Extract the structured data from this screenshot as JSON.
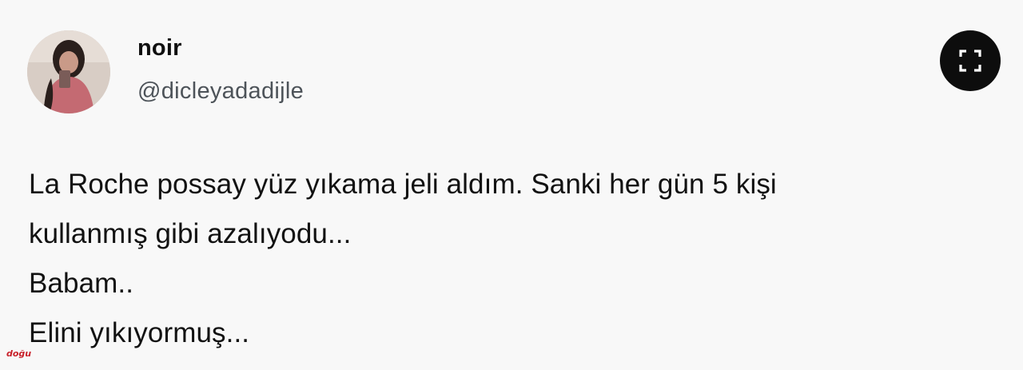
{
  "author": {
    "display_name": "noir",
    "handle": "@dicleyadadijle"
  },
  "tweet": {
    "lines": [
      "La Roche possay yüz yıkama jeli aldım. Sanki her gün 5 kişi",
      "kullanmış gibi azalıyodu...",
      "Babam..",
      "Elini yıkıyormuş..."
    ]
  },
  "controls": {
    "expand_icon": "expand-icon"
  },
  "watermark": {
    "text": "doğu"
  },
  "colors": {
    "background": "#f8f8f8",
    "handle": "#4d5359",
    "expand_button": "#0d0d0d",
    "watermark": "#c8202a"
  }
}
